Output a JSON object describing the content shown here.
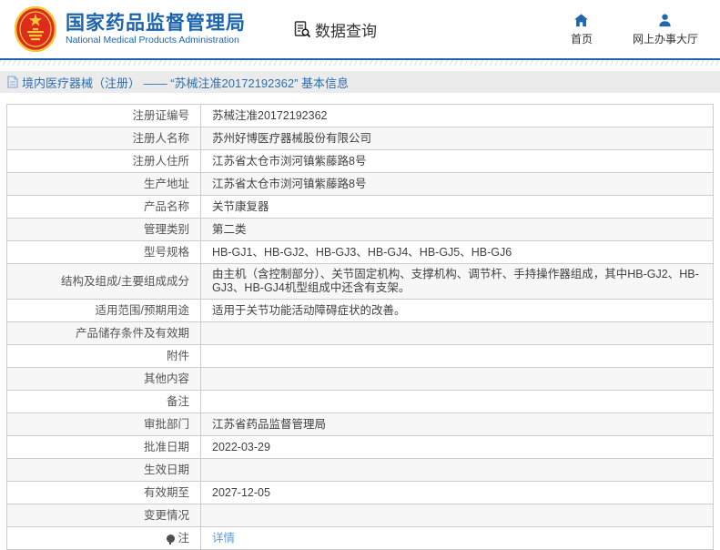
{
  "header": {
    "logo": {
      "emblem_icon": "national-emblem",
      "title": "国家药品监督管理局",
      "subtitle": "National Medical Products Administration"
    },
    "section": {
      "icon": "document-search-icon",
      "label": "数据查询"
    },
    "nav": [
      {
        "icon": "home-icon",
        "label": "首页"
      },
      {
        "icon": "user-icon",
        "label": "网上办事大厅"
      }
    ]
  },
  "breadcrumb": {
    "icon": "document-icon",
    "text": "境内医疗器械（注册） —— “苏械注准20172192362” 基本信息"
  },
  "table": {
    "rows": [
      {
        "label": "注册证编号",
        "value": "苏械注准20172192362"
      },
      {
        "label": "注册人名称",
        "value": "苏州好博医疗器械股份有限公司"
      },
      {
        "label": "注册人住所",
        "value": "江苏省太仓市浏河镇紫藤路8号"
      },
      {
        "label": "生产地址",
        "value": "江苏省太仓市浏河镇紫藤路8号"
      },
      {
        "label": "产品名称",
        "value": "关节康复器"
      },
      {
        "label": "管理类别",
        "value": "第二类"
      },
      {
        "label": "型号规格",
        "value": "HB-GJ1、HB-GJ2、HB-GJ3、HB-GJ4、HB-GJ5、HB-GJ6"
      },
      {
        "label": "结构及组成/主要组成成分",
        "value": "由主机（含控制部分）、关节固定机构、支撑机构、调节杆、手持操作器组成，其中HB-GJ2、HB-GJ3、HB-GJ4机型组成中还含有支架。"
      },
      {
        "label": "适用范围/预期用途",
        "value": "适用于关节功能活动障碍症状的改善。"
      },
      {
        "label": "产品储存条件及有效期",
        "value": ""
      },
      {
        "label": "附件",
        "value": ""
      },
      {
        "label": "其他内容",
        "value": ""
      },
      {
        "label": "备注",
        "value": ""
      },
      {
        "label": "审批部门",
        "value": "江苏省药品监督管理局"
      },
      {
        "label": "批准日期",
        "value": "2022-03-29"
      },
      {
        "label": "生效日期",
        "value": ""
      },
      {
        "label": "有效期至",
        "value": "2027-12-05"
      },
      {
        "label": "变更情况",
        "value": ""
      },
      {
        "label": "注",
        "value": "详情",
        "value_is_link": true,
        "label_icon": "note-icon"
      }
    ]
  },
  "colors": {
    "brand_blue": "#1b64af",
    "header_rule_blue": "#2265ae",
    "breadcrumb_blue": "#2d6eb0",
    "link_blue": "#5b9bd5",
    "alt_row_bg": "#f7f7f7",
    "table_border": "#cccccc",
    "emblem_red": "#dd2b1c",
    "emblem_gold": "#f3c73c"
  }
}
